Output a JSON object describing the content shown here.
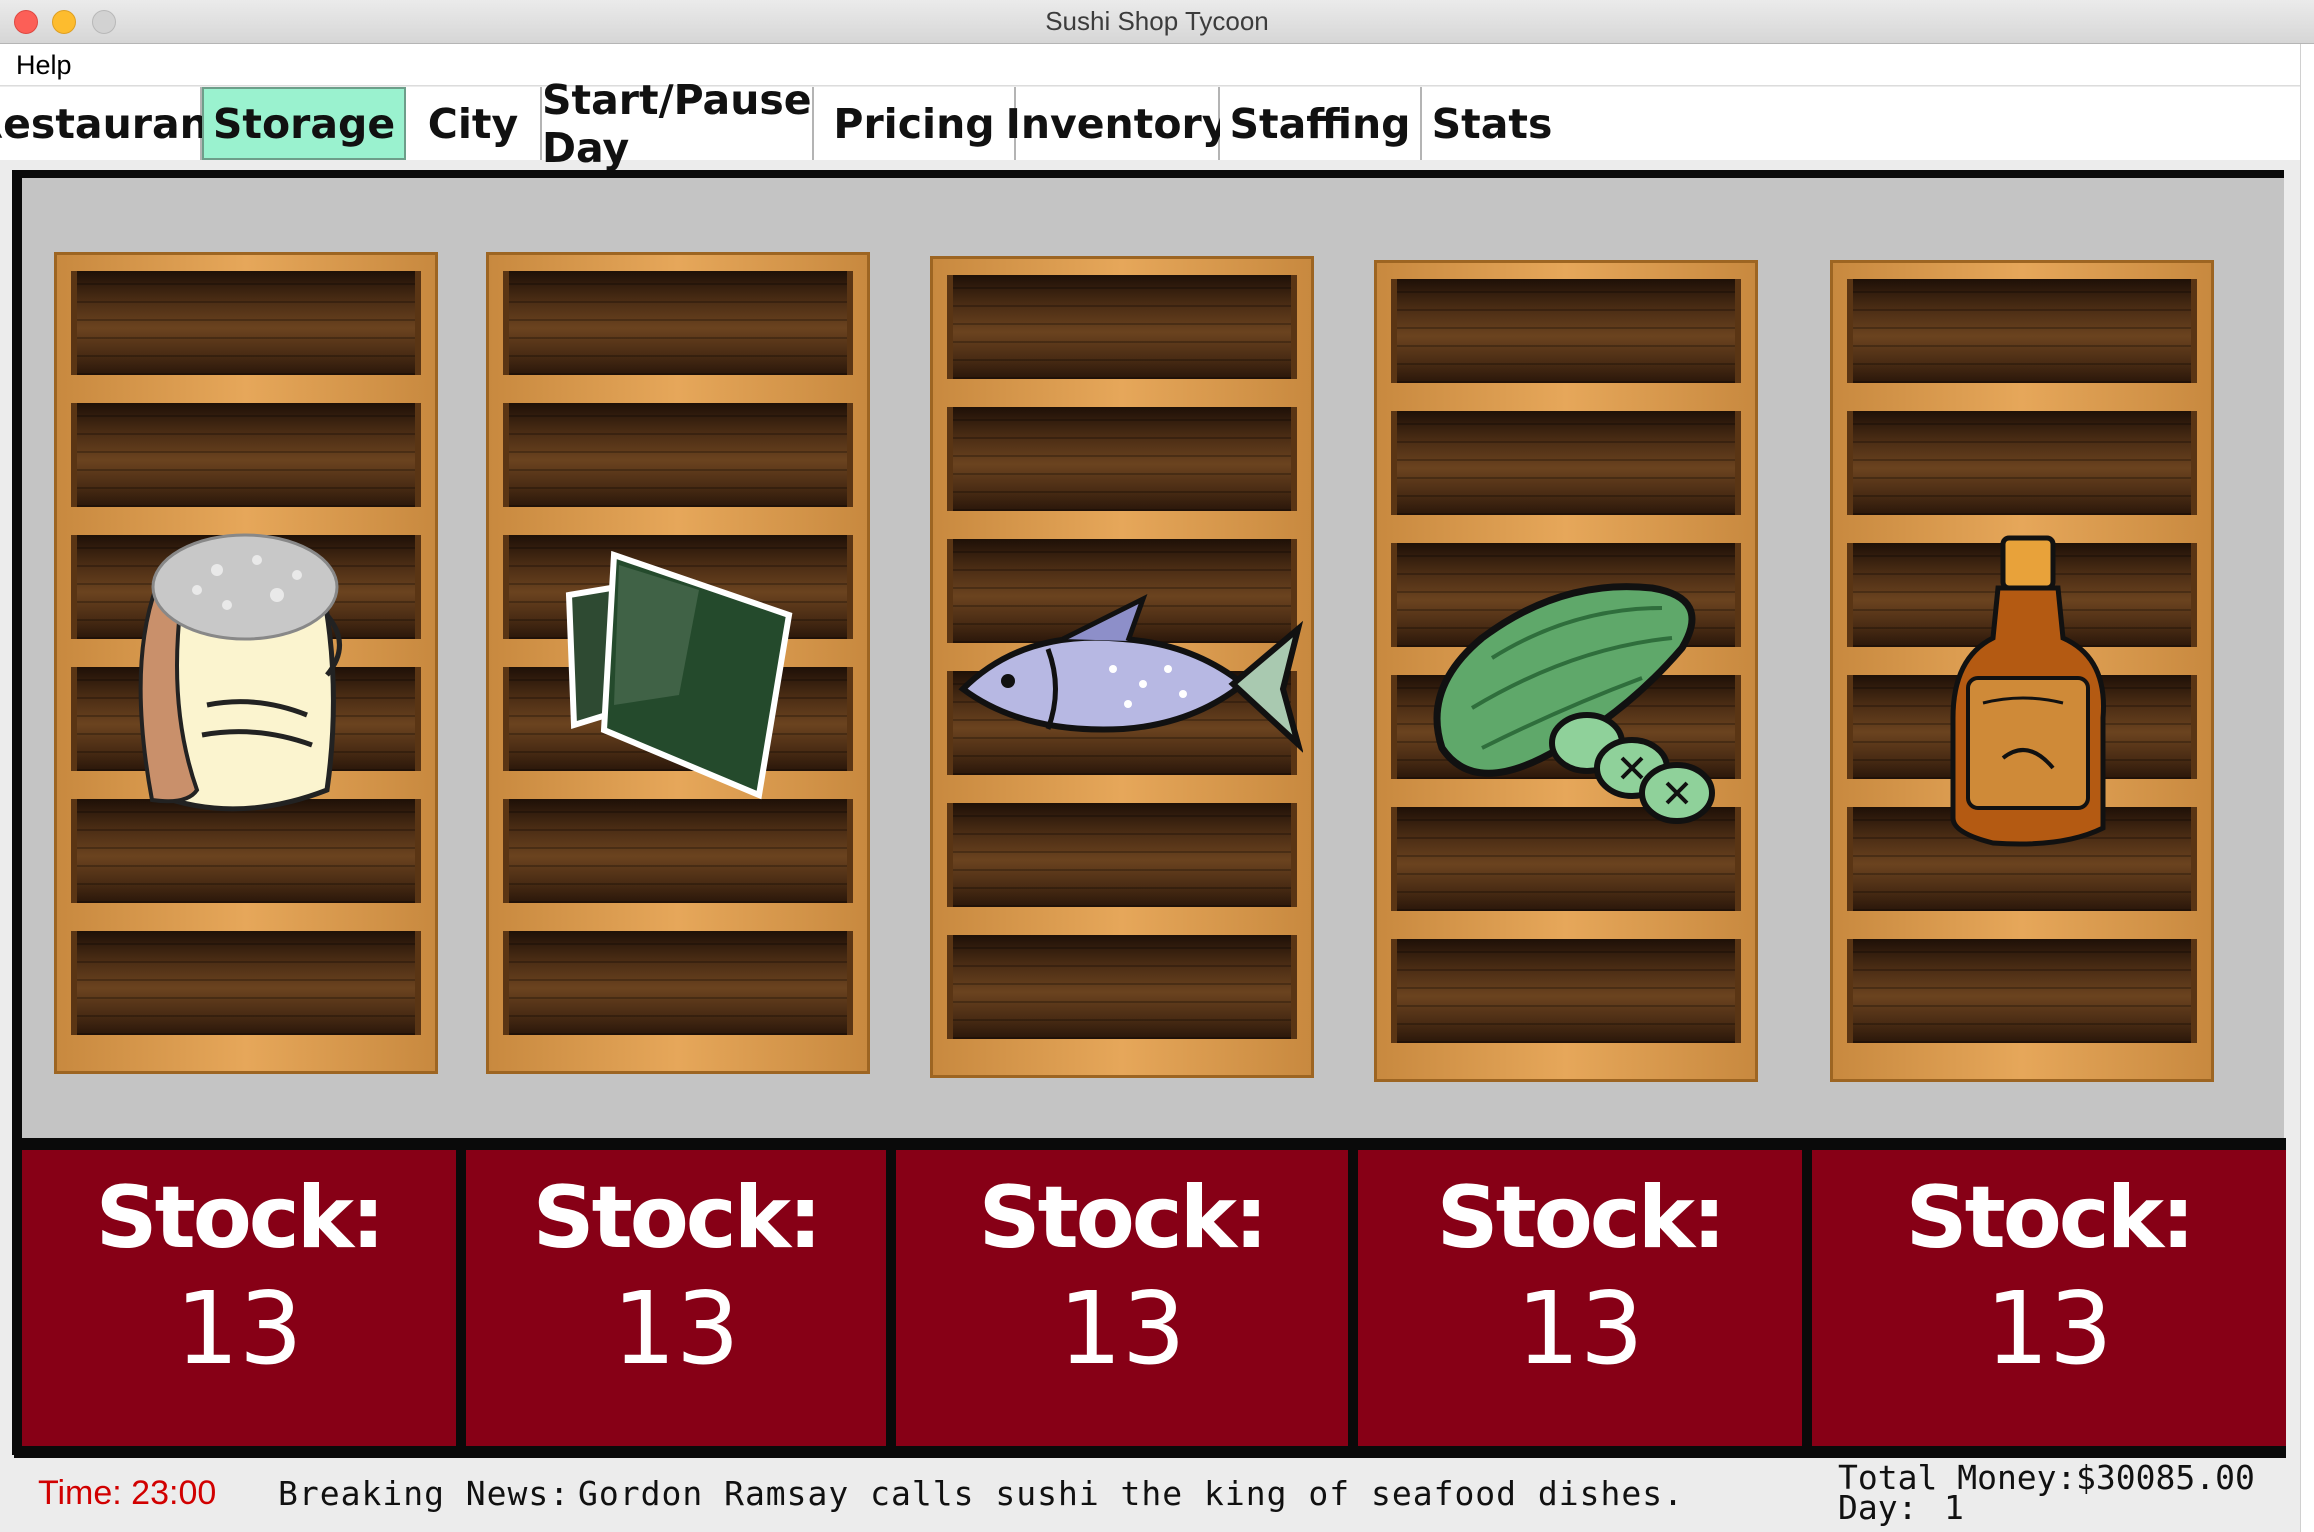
{
  "window": {
    "title": "Sushi Shop Tycoon"
  },
  "menu": {
    "help_label": "Help"
  },
  "tabs": [
    {
      "label": "Restaurant",
      "active": false
    },
    {
      "label": "Storage",
      "active": true
    },
    {
      "label": "City",
      "active": false
    },
    {
      "label": "Start/Pause Day",
      "active": false
    },
    {
      "label": "Pricing",
      "active": false
    },
    {
      "label": "Inventory",
      "active": false
    },
    {
      "label": "Staffing",
      "active": false
    },
    {
      "label": "Stats",
      "active": false
    }
  ],
  "storage": {
    "shelves": [
      {
        "item_icon": "rice-sack-icon",
        "stock_label": "Stock:",
        "stock_value": "13"
      },
      {
        "item_icon": "seaweed-sheets-icon",
        "stock_label": "Stock:",
        "stock_value": "13"
      },
      {
        "item_icon": "fish-icon",
        "stock_label": "Stock:",
        "stock_value": "13"
      },
      {
        "item_icon": "cucumber-icon",
        "stock_label": "Stock:",
        "stock_value": "13"
      },
      {
        "item_icon": "soy-sauce-bottle-icon",
        "stock_label": "Stock:",
        "stock_value": "13"
      }
    ]
  },
  "status": {
    "time_text": "Time: 23:00",
    "news_label": "Breaking News:",
    "news_text": "Gordon Ramsay calls sushi the king of seafood dishes.",
    "money_label": "Total Money:",
    "money_value": "$30085.00",
    "day_label": "Day:",
    "day_value": "1"
  },
  "colors": {
    "active_tab": "#9af2cf",
    "stock_panel": "#870016",
    "time_text": "#d10000"
  }
}
